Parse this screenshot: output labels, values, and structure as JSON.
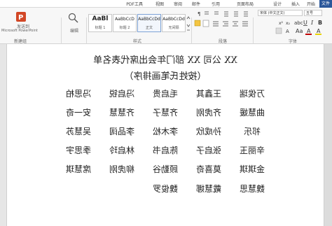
{
  "ribbon": {
    "tabs": {
      "file": "文件",
      "home": "开始",
      "insert": "插入",
      "design": "设计",
      "layout": "页面布局",
      "references": "引用",
      "mailings": "邮件",
      "review": "审阅",
      "view": "视图",
      "pdf_tools": "PDF工具",
      "blank1": "",
      "blank2": ""
    },
    "font_name": "宋体 (中文正文)",
    "font_size": "五号",
    "group_font": "字体",
    "group_paragraph": "段落",
    "group_styles": "样式",
    "group_editing": "编辑",
    "group_new": "新建组",
    "styles": [
      {
        "sample": "AaBbCcDd",
        "name": "正文"
      },
      {
        "sample": "AaBbCcDd",
        "name": "无间隔"
      },
      {
        "sample": "AaBl",
        "name": "标题 1"
      },
      {
        "sample": "AaBbCcD",
        "name": "标题 2"
      }
    ],
    "editing_label": "编辑",
    "send_label": "发送到",
    "send_sub": "Microsoft PowerPoint"
  },
  "doc": {
    "title": "XX 公司 XX 部门年会出席代表名单",
    "subtitle": "（按姓氏笔画排序）",
    "names": [
      [
        "万俟瑞",
        "王鑫其",
        "毛启贵",
        "冯启锐",
        "冯思柏"
      ],
      [
        "曲慧媛",
        "齐虎刚",
        "齐慧子",
        "齐慧慧",
        "安一奇"
      ],
      [
        "祁乐",
        "孙成欣",
        "李木松",
        "李品阔",
        "吴慧苏"
      ],
      [
        "辛丽玉",
        "张启子",
        "陈启书",
        "林启玲",
        "季思宇"
      ],
      [
        "金琪琪",
        "莫喜奇",
        "顾勤谷",
        "柳虎刚",
        "席慧琪"
      ],
      [
        "魏慧思",
        "戴慧娜",
        "魏俊罗"
      ]
    ]
  }
}
